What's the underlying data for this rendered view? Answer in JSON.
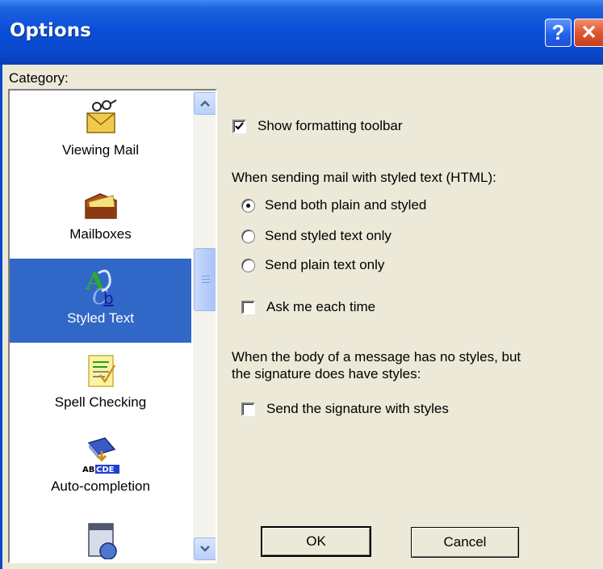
{
  "window": {
    "title": "Options",
    "help_glyph": "?",
    "close_glyph": "✕"
  },
  "category": {
    "label": "Category:",
    "items": [
      {
        "label": "Viewing Mail",
        "icon": "viewing-mail-icon",
        "selected": false
      },
      {
        "label": "Mailboxes",
        "icon": "mailboxes-icon",
        "selected": false
      },
      {
        "label": "Styled Text",
        "icon": "styled-text-icon",
        "selected": true
      },
      {
        "label": "Spell Checking",
        "icon": "spell-checking-icon",
        "selected": false
      },
      {
        "label": "Auto-completion",
        "icon": "auto-completion-icon",
        "selected": false
      },
      {
        "label": "",
        "icon": "calendar-clock-icon",
        "selected": false
      }
    ],
    "scroll_position": 0.4
  },
  "options": {
    "show_formatting_toolbar": {
      "label": "Show formatting toolbar",
      "checked": true
    },
    "html_prompt": "When sending mail with styled text (HTML):",
    "send_mode": [
      {
        "label": "Send both plain and styled",
        "selected": true
      },
      {
        "label": "Send styled text only",
        "selected": false
      },
      {
        "label": "Send plain text only",
        "selected": false
      }
    ],
    "ask_each_time": {
      "label": "Ask me each time",
      "checked": false
    },
    "signature_prompt_line1": "When the body of a message has no styles, but",
    "signature_prompt_line2": "the signature does have styles:",
    "send_signature_styles": {
      "label": "Send the signature with styles",
      "checked": false
    }
  },
  "buttons": {
    "ok": "OK",
    "cancel": "Cancel"
  },
  "colors": {
    "titlebar": "#0a48cc",
    "selection": "#3167c6",
    "dialog_bg": "#ece9d8"
  }
}
